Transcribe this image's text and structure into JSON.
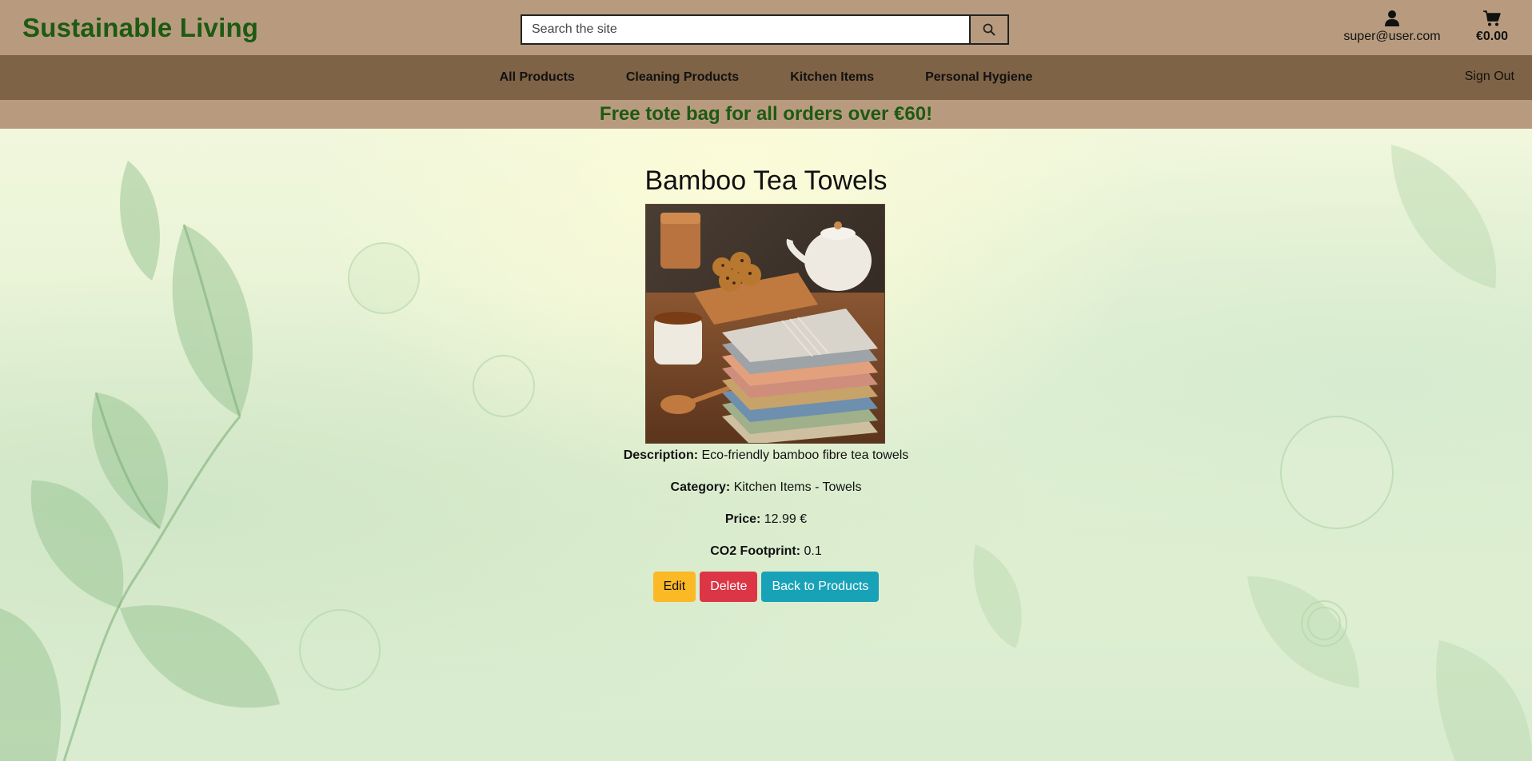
{
  "header": {
    "brand": "Sustainable Living",
    "search": {
      "placeholder": "Search the site",
      "value": ""
    },
    "account_email": "super@user.com",
    "cart_total": "€0.00"
  },
  "nav": {
    "items": [
      {
        "label": "All Products"
      },
      {
        "label": "Cleaning Products"
      },
      {
        "label": "Kitchen Items"
      },
      {
        "label": "Personal Hygiene"
      }
    ],
    "signout": "Sign Out"
  },
  "promo": "Free tote bag for all orders over €60!",
  "product": {
    "title": "Bamboo Tea Towels",
    "description_label": "Description:",
    "description": "Eco-friendly bamboo fibre tea towels",
    "category_label": "Category:",
    "category": "Kitchen Items - Towels",
    "price_label": "Price:",
    "price": "12.99 €",
    "co2_label": "CO2 Footprint:",
    "co2": "0.1"
  },
  "actions": {
    "edit": "Edit",
    "delete": "Delete",
    "back": "Back to Products"
  },
  "colors": {
    "header_bg": "#b89b7f",
    "nav_bg": "#7f6346",
    "brand_green": "#1d5a12",
    "edit": "#fbb926",
    "delete": "#dc3545",
    "back": "#17a2b8"
  },
  "icons": {
    "search": "search-icon",
    "user": "user-icon",
    "cart": "cart-icon"
  }
}
